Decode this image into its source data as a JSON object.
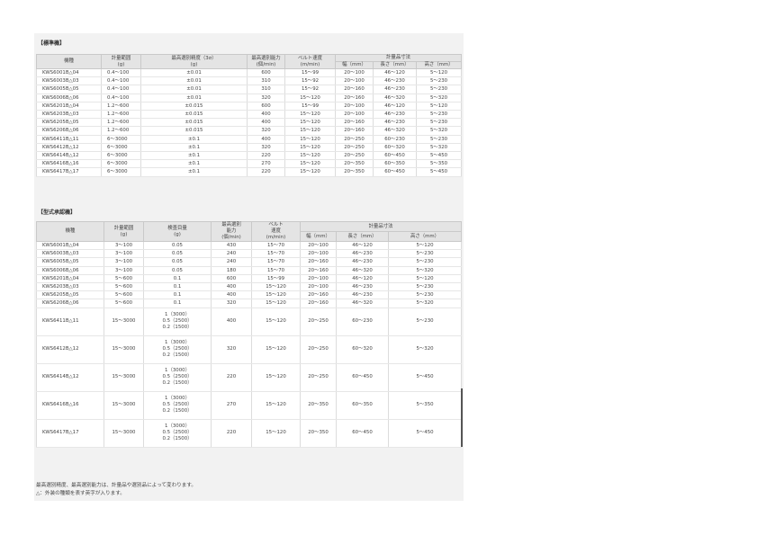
{
  "section1": {
    "title": "【標準機】",
    "headers": [
      "機種",
      "計量範囲",
      "(g)",
      "最高選別精度（3σ）",
      "(g)",
      "最高選別能力",
      "(個/min)",
      "ベルト速度",
      "(m/min)",
      "計量品寸法",
      "幅（mm）",
      "長さ（mm）",
      "高さ（mm）"
    ],
    "rows": [
      [
        "KWS6001B△04",
        "0.4～100",
        "±0.01",
        "600",
        "15～99",
        "20～100",
        "46～120",
        "5～120"
      ],
      [
        "KWS6003B△03",
        "0.4～100",
        "±0.01",
        "310",
        "15～92",
        "20～100",
        "46～230",
        "5～230"
      ],
      [
        "KWS6005B△05",
        "0.4～100",
        "±0.01",
        "310",
        "15～92",
        "20～160",
        "46～230",
        "5～230"
      ],
      [
        "KWS6006B△06",
        "0.4～100",
        "±0.01",
        "320",
        "15～120",
        "20～160",
        "46～320",
        "5～320"
      ],
      [
        "KWS6201B△04",
        "1.2～600",
        "±0.015",
        "600",
        "15～99",
        "20～100",
        "46～120",
        "5～120"
      ],
      [
        "KWS6203B△03",
        "1.2～600",
        "±0.015",
        "400",
        "15～120",
        "20～100",
        "46～230",
        "5～230"
      ],
      [
        "KWS6205B△05",
        "1.2～600",
        "±0.015",
        "400",
        "15～120",
        "20～160",
        "46～230",
        "5～230"
      ],
      [
        "KWS6206B△06",
        "1.2～600",
        "±0.015",
        "320",
        "15～120",
        "20～160",
        "46～320",
        "5～320"
      ],
      [
        "KWS6411B△11",
        "6～3000",
        "±0.1",
        "400",
        "15～120",
        "20～250",
        "60～230",
        "5～230"
      ],
      [
        "KWS6412B△12",
        "6～3000",
        "±0.1",
        "320",
        "15～120",
        "20～250",
        "60～320",
        "5～320"
      ],
      [
        "KWS6414B△12",
        "6～3000",
        "±0.1",
        "220",
        "15～120",
        "20～250",
        "60～450",
        "5～450"
      ],
      [
        "KWS6416B△16",
        "6～3000",
        "±0.1",
        "270",
        "15～120",
        "20～350",
        "60～350",
        "5～350"
      ],
      [
        "KWS6417B△17",
        "6～3000",
        "±0.1",
        "220",
        "15～120",
        "20～350",
        "60～450",
        "5～450"
      ]
    ]
  },
  "section2": {
    "title": "【型式承認機】",
    "headers": [
      "機種",
      "計量範囲",
      "(g)",
      "検査目量",
      "(g)",
      "最高選別",
      "能力",
      "(個/min)",
      "ベルト",
      "速度",
      "(m/min)",
      "計量品寸法",
      "幅（mm）",
      "長さ（mm）",
      "高さ（mm）"
    ],
    "rows": [
      [
        "KWS6001B△04",
        "3～100",
        "0.05",
        "430",
        "15～70",
        "20～100",
        "46～120",
        "5～120"
      ],
      [
        "KWS6003B△03",
        "3～100",
        "0.05",
        "240",
        "15～70",
        "20～100",
        "46～230",
        "5～230"
      ],
      [
        "KWS6005B△05",
        "3～100",
        "0.05",
        "240",
        "15～70",
        "20～160",
        "46～230",
        "5～230"
      ],
      [
        "KWS6006B△06",
        "3～100",
        "0.05",
        "180",
        "15～70",
        "20～160",
        "46～320",
        "5～320"
      ],
      [
        "KWS6201B△04",
        "5～600",
        "0.1",
        "600",
        "15～99",
        "20～100",
        "46～120",
        "5～120"
      ],
      [
        "KWS6203B△03",
        "5～600",
        "0.1",
        "400",
        "15～120",
        "20～100",
        "46～230",
        "5～230"
      ],
      [
        "KWS6205B△05",
        "5～600",
        "0.1",
        "400",
        "15～120",
        "20～160",
        "46～230",
        "5～230"
      ],
      [
        "KWS6206B△06",
        "5～600",
        "0.1",
        "320",
        "15～120",
        "20～160",
        "46～320",
        "5～320"
      ]
    ],
    "ml_rows": [
      {
        "model": "KWS6411B△11",
        "range": "15～3000",
        "div": [
          "1（3000）",
          "0.5（2500）",
          "0.2（1500）"
        ],
        "cap": "400",
        "speed": "15～120",
        "w": "20～250",
        "len": "60～230",
        "h": "5～230"
      },
      {
        "model": "KWS6412B△12",
        "range": "15～3000",
        "div": [
          "1（3000）",
          "0.5（2500）",
          "0.2（1500）"
        ],
        "cap": "320",
        "speed": "15～120",
        "w": "20～250",
        "len": "60～320",
        "h": "5～320"
      },
      {
        "model": "KWS6414B△12",
        "range": "15～3000",
        "div": [
          "1（3000）",
          "0.5（2500）",
          "0.2（1500）"
        ],
        "cap": "220",
        "speed": "15～120",
        "w": "20～250",
        "len": "60～450",
        "h": "5～450"
      },
      {
        "model": "KWS6416B△16",
        "range": "15～3000",
        "div": [
          "1（3000）",
          "0.5（2500）",
          "0.2（1500）"
        ],
        "cap": "270",
        "speed": "15～120",
        "w": "20～350",
        "len": "60～350",
        "h": "5～350"
      },
      {
        "model": "KWS6417B△17",
        "range": "15～3000",
        "div": [
          "1（3000）",
          "0.5（2500）",
          "0.2（1500）"
        ],
        "cap": "220",
        "speed": "15～120",
        "w": "20～350",
        "len": "60～450",
        "h": "5～450"
      }
    ]
  },
  "notes": [
    "最高選別精度、最高選別能力は、計量品や選別品によって変わります。",
    "△：外装の種類を表す英字が入ります。"
  ]
}
